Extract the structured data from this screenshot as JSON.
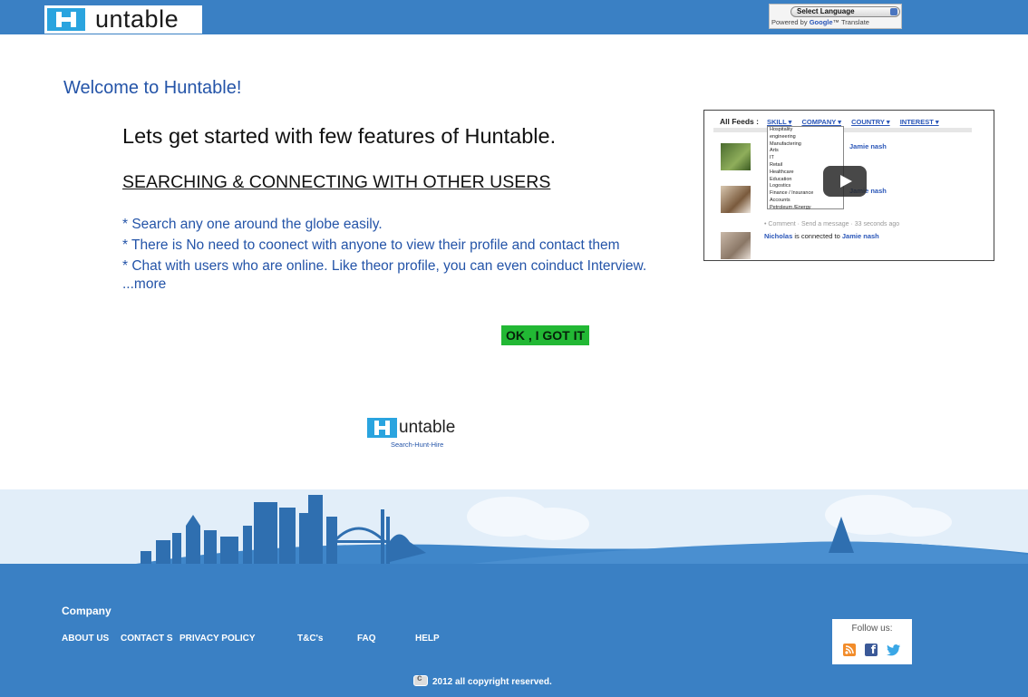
{
  "header": {
    "logo_text": "untable",
    "translate": {
      "select_label": "Select Language",
      "powered_prefix": "Powered by ",
      "powered_brand": "Google",
      "powered_suffix": "™ Translate"
    }
  },
  "main": {
    "welcome": "Welcome to Huntable!",
    "intro": "Lets get started with few features of Huntable.",
    "section_title": "SEARCHING & CONNECTING WITH OTHER USERS",
    "features": [
      "* Search any one around the globe easily.",
      "* There is No need to coonect with anyone to view their profile and contact them",
      "* Chat with users who are online. Like theor profile, you can even coinduct Interview."
    ],
    "more_link": "...more",
    "ok_button": "OK , I GOT IT"
  },
  "video": {
    "feeds_label": "All Feeds :",
    "filters": [
      "SKILL ▾",
      "COMPANY ▾",
      "COUNTRY ▾",
      "INTEREST ▾"
    ],
    "dropdown_items": [
      "Hospitality",
      "engineering",
      "Manufactering",
      "Arts",
      "IT",
      "Retail",
      "Healthcare",
      "Education",
      "Logostics",
      "Finance / Insurance",
      "Accounts",
      "Petroleum /Energy"
    ],
    "line1_link": "Jamie nash",
    "line2_link": "Jamie nash",
    "meta": "• Comment · Send a message · 33 seconds ago",
    "line3_name": "Nicholas",
    "line3_text": " is connected to ",
    "line3_link": "Jamie nash"
  },
  "logo2": {
    "text": "untable",
    "tagline": "Search-Hunt-Hire"
  },
  "footer": {
    "company_heading": "Company",
    "links": [
      "ABOUT US",
      "CONTACT S",
      "PRIVACY POLICY",
      "T&C's",
      "FAQ",
      "HELP"
    ],
    "follow_label": "Follow us:",
    "copyright": "2012 all copyright reserved."
  },
  "colors": {
    "brand_blue": "#3a80c4",
    "logo_cyan": "#2aa4df",
    "text_blue": "#2454a8",
    "ok_green": "#22b834"
  },
  "icons": [
    "play-icon",
    "blog-icon",
    "facebook-icon",
    "twitter-icon",
    "copyright-icon"
  ]
}
